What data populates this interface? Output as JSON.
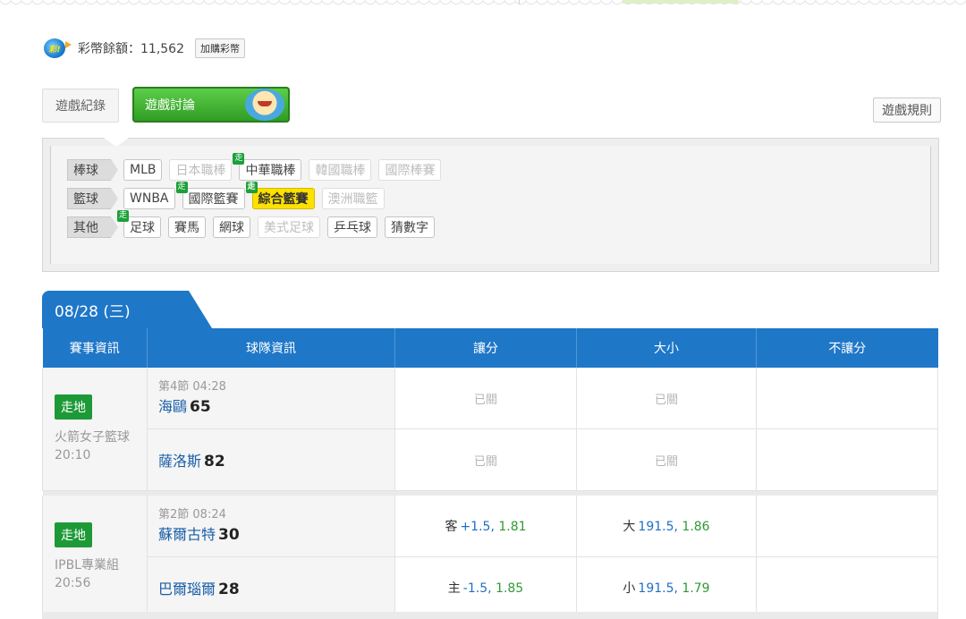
{
  "account": {
    "coin_icon_text": "彩!",
    "balance_label": "彩幣餘額：11,562",
    "buy_button": "加購彩幣"
  },
  "tabs": {
    "record": "遊戲紀錄",
    "discuss": "遊戲討論",
    "rules": "遊戲規則"
  },
  "filters": {
    "walk_badge": "走",
    "rows": [
      {
        "category": "棒球",
        "items": [
          {
            "label": "MLB",
            "state": "active",
            "walk": false
          },
          {
            "label": "日本職棒",
            "state": "disabled",
            "walk": false
          },
          {
            "label": "中華職棒",
            "state": "active",
            "walk": true
          },
          {
            "label": "韓國職棒",
            "state": "disabled",
            "walk": false
          },
          {
            "label": "國際棒賽",
            "state": "disabled",
            "walk": false
          }
        ]
      },
      {
        "category": "籃球",
        "items": [
          {
            "label": "WNBA",
            "state": "active",
            "walk": false
          },
          {
            "label": "國際籃賽",
            "state": "active",
            "walk": true
          },
          {
            "label": "綜合籃賽",
            "state": "selected",
            "walk": true
          },
          {
            "label": "澳洲職籃",
            "state": "disabled",
            "walk": false
          }
        ]
      },
      {
        "category": "其他",
        "items": [
          {
            "label": "足球",
            "state": "active",
            "walk": true
          },
          {
            "label": "賽馬",
            "state": "active",
            "walk": false
          },
          {
            "label": "網球",
            "state": "active",
            "walk": false
          },
          {
            "label": "美式足球",
            "state": "disabled",
            "walk": false
          },
          {
            "label": "乒乓球",
            "state": "active",
            "walk": false
          },
          {
            "label": "猜數字",
            "state": "active",
            "walk": false
          }
        ]
      }
    ]
  },
  "date_tab": "08/28 (三)",
  "table": {
    "headers": [
      "賽事資訊",
      "球隊資訊",
      "讓分",
      "大小",
      "不讓分"
    ],
    "matches": [
      {
        "live_badge": "走地",
        "league": "火箭女子籃球",
        "time": "20:10",
        "period": "第4節 04:28",
        "teams": [
          {
            "name": "海鷗",
            "score": "65",
            "spread": {
              "closed": "已關"
            },
            "total": {
              "closed": "已關"
            }
          },
          {
            "name": "薩洛斯",
            "score": "82",
            "spread": {
              "closed": "已關"
            },
            "total": {
              "closed": "已關"
            }
          }
        ]
      },
      {
        "live_badge": "走地",
        "league": "IPBL專業組",
        "time": "20:56",
        "period": "第2節 08:24",
        "teams": [
          {
            "name": "蘇爾古特",
            "score": "30",
            "spread": {
              "side": "客",
              "line": "+1.5,",
              "odds": "1.81"
            },
            "total": {
              "side": "大",
              "line": "191.5,",
              "odds": "1.86"
            }
          },
          {
            "name": "巴爾瑙爾",
            "score": "28",
            "spread": {
              "side": "主",
              "line": "-1.5,",
              "odds": "1.85"
            },
            "total": {
              "side": "小",
              "line": "191.5,",
              "odds": "1.79"
            }
          }
        ]
      }
    ]
  }
}
